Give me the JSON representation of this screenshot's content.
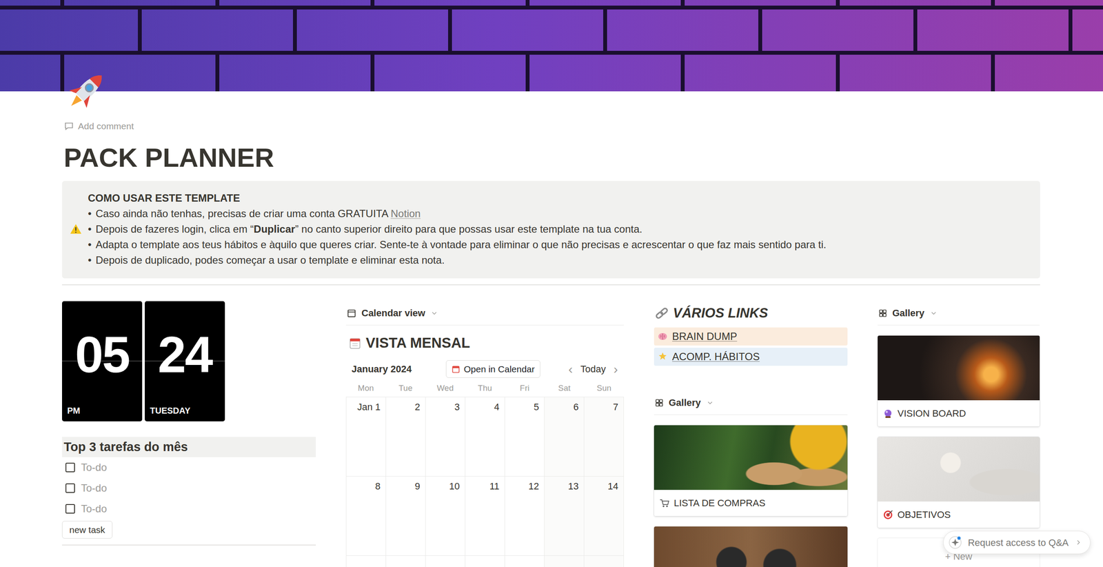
{
  "page": {
    "add_comment": "Add comment",
    "title": "PACK PLANNER"
  },
  "callout": {
    "title": "COMO USAR ESTE TEMPLATE",
    "bullet": "•",
    "items": [
      {
        "segments": [
          {
            "text": "Caso ainda não tenhas, precisas de criar uma conta GRATUITA ",
            "kind": "plain"
          },
          {
            "text": "Notion",
            "kind": "link"
          }
        ]
      },
      {
        "segments": [
          {
            "text": "Depois de fazeres login, clica em “",
            "kind": "plain"
          },
          {
            "text": "Duplicar",
            "kind": "bold"
          },
          {
            "text": "” no canto superior direito para que possas usar este template na tua conta.",
            "kind": "plain"
          }
        ]
      },
      {
        "segments": [
          {
            "text": "Adapta o template aos teus hábitos e àquilo que queres criar. Sente-te à vontade para eliminar o que não precisas e acrescentar o que faz mais sentido para ti.",
            "kind": "plain"
          }
        ]
      },
      {
        "segments": [
          {
            "text": "Depois de duplicado, podes começar a usar o template e eliminar esta nota.",
            "kind": "plain"
          }
        ]
      }
    ]
  },
  "clock": {
    "hour": "05",
    "minute": "24",
    "period": "PM",
    "day": "TUESDAY"
  },
  "tasks": {
    "title": "Top 3 tarefas do mês",
    "items": [
      {
        "label": "To-do",
        "checked": false
      },
      {
        "label": "To-do",
        "checked": false
      },
      {
        "label": "To-do",
        "checked": false
      }
    ],
    "button": "new task"
  },
  "calendar": {
    "view": "Calendar view",
    "title": "VISTA MENSAL",
    "month": "January 2024",
    "open_button": "Open in Calendar",
    "prev": "‹",
    "today": "Today",
    "next": "›",
    "weekdays": [
      {
        "label": "Mon",
        "weekend": false
      },
      {
        "label": "Tue",
        "weekend": false
      },
      {
        "label": "Wed",
        "weekend": false
      },
      {
        "label": "Thu",
        "weekend": false
      },
      {
        "label": "Fri",
        "weekend": false
      },
      {
        "label": "Sat",
        "weekend": true
      },
      {
        "label": "Sun",
        "weekend": true
      }
    ],
    "weeks": [
      [
        "Jan 1",
        "2",
        "3",
        "4",
        "5",
        "6",
        "7"
      ],
      [
        "8",
        "9",
        "10",
        "11",
        "12",
        "13",
        "14"
      ]
    ]
  },
  "links": {
    "title": "VÁRIOS LINKS",
    "items": [
      {
        "label": "BRAIN DUMP",
        "color": "#fbecdd"
      },
      {
        "label": "ACOMP. HÁBITOS",
        "color": "#e7f0f8"
      }
    ]
  },
  "gallery_links": {
    "view": "Gallery",
    "cards": [
      {
        "title": "LISTA DE COMPRAS"
      }
    ]
  },
  "gallery_main": {
    "view": "Gallery",
    "cards": [
      {
        "title": "VISION BOARD"
      },
      {
        "title": "OBJETIVOS"
      }
    ],
    "new_label": "+ New"
  },
  "qa": {
    "label": "Request access to Q&A"
  }
}
